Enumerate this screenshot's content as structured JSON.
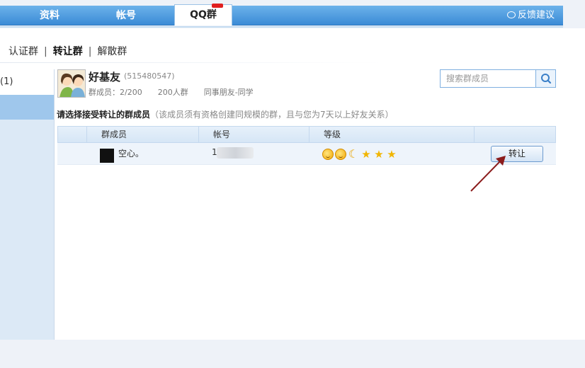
{
  "tabs": {
    "profile": "资料",
    "account": "帐号",
    "qq_group": "QQ群"
  },
  "feedback_label": "反馈建议",
  "subnav": {
    "certify": "认证群",
    "transfer": "转让群",
    "dissolve": "解散群"
  },
  "sidebar": {
    "count_label": "(1)"
  },
  "group": {
    "name": "好基友",
    "id": "(515480547)",
    "members": "群成员：2/200",
    "size": "200人群",
    "category": "同事朋友-同学"
  },
  "search": {
    "placeholder": "搜索群成员"
  },
  "instruction": {
    "title": "请选择接受转让的群成员",
    "note": "（该成员须有资格创建同规模的群，且与您为7天以上好友关系）"
  },
  "table": {
    "headers": [
      "群成员",
      "帐号",
      "等级"
    ],
    "rows": [
      {
        "member": "空心。",
        "account": "1",
        "level_icons": [
          "sun-icon",
          "sun-icon",
          "moon-icon",
          "star-icon",
          "star-icon",
          "star-icon"
        ],
        "action": "转让"
      }
    ]
  },
  "colors": {
    "tab_blue": "#3b8bd6",
    "sidebar_selected": "#9fc7ec",
    "arrow": "#8b1c1c"
  }
}
